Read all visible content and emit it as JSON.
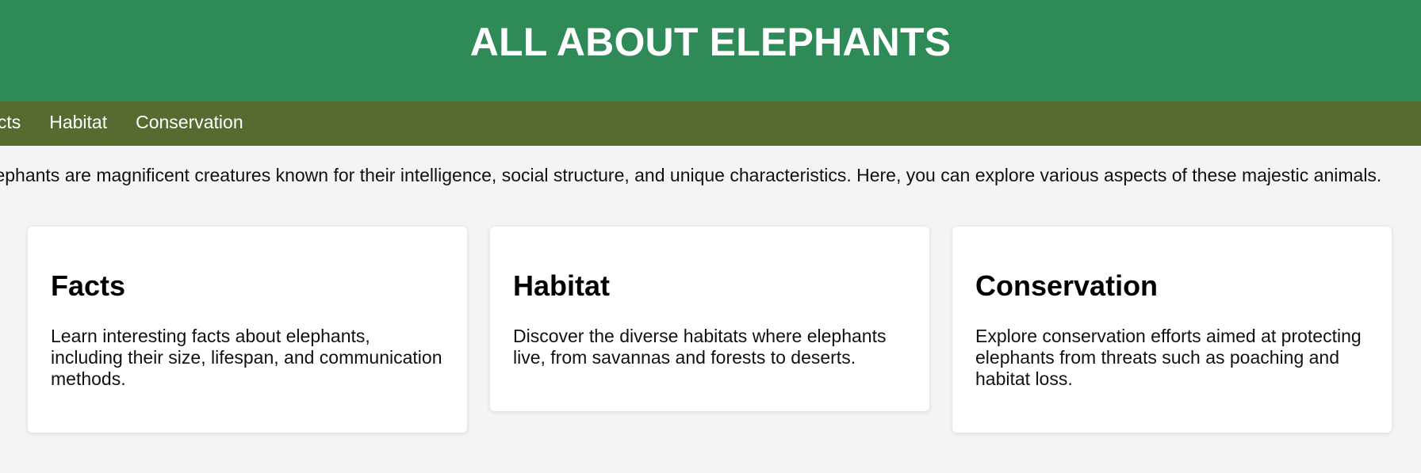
{
  "header": {
    "title": "ALL ABOUT ELEPHANTS"
  },
  "nav": {
    "items": [
      {
        "label": "Facts"
      },
      {
        "label": "Habitat"
      },
      {
        "label": "Conservation"
      }
    ]
  },
  "intro": {
    "text": "Elephants are magnificent creatures known for their intelligence, social structure, and unique characteristics. Here, you can explore various aspects of these majestic animals."
  },
  "cards": [
    {
      "title": "Facts",
      "body": "Learn interesting facts about elephants, including their size, lifespan, and communication methods."
    },
    {
      "title": "Habitat",
      "body": "Discover the diverse habitats where elephants live, from savannas and forests to deserts."
    },
    {
      "title": "Conservation",
      "body": "Explore conservation efforts aimed at protecting elephants from threats such as poaching and habitat loss."
    }
  ],
  "colors": {
    "header_bg": "#2e8b57",
    "nav_bg": "#556b2f",
    "page_bg": "#f4f4f4",
    "card_bg": "#ffffff"
  }
}
